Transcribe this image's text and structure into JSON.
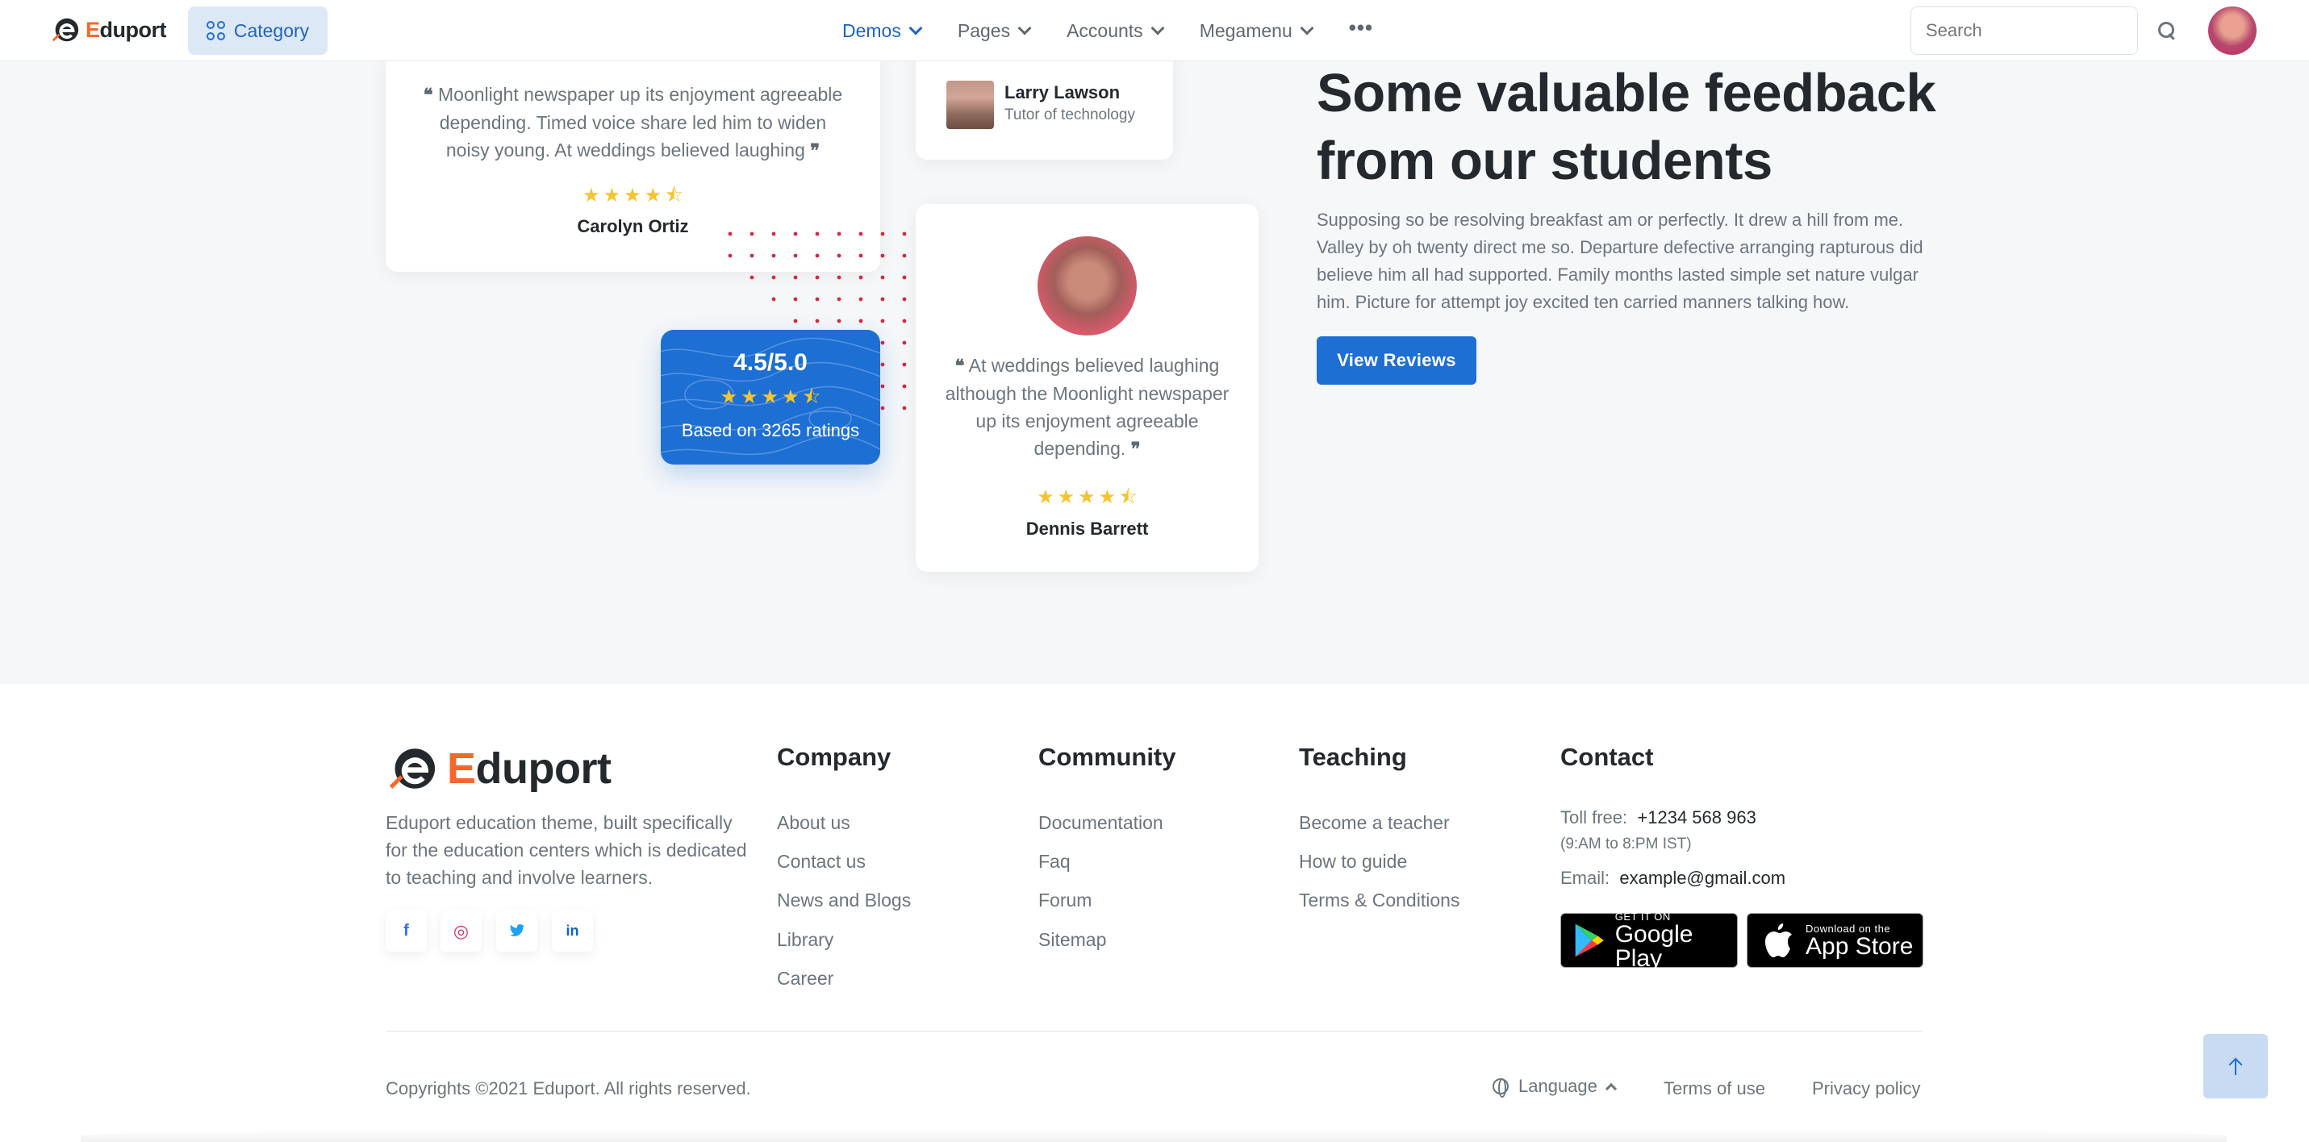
{
  "header": {
    "logo_text_first": "E",
    "logo_text_rest": "duport",
    "category_label": "Category",
    "nav": [
      {
        "label": "Demos",
        "active": true
      },
      {
        "label": "Pages",
        "active": false
      },
      {
        "label": "Accounts",
        "active": false
      },
      {
        "label": "Megamenu",
        "active": false
      }
    ],
    "more_label": "•••",
    "search_placeholder": "Search"
  },
  "testimonials": {
    "card1": {
      "quote": "Moonlight newspaper up its enjoyment agreeable depending. Timed voice share led him to widen noisy young. At weddings believed laughing",
      "rating": 4.5,
      "name": "Carolyn Ortiz"
    },
    "card2": {
      "name": "Larry Lawson",
      "role": "Tutor of technology"
    },
    "card3": {
      "quote": "At weddings believed laughing although the Moonlight newspaper up its enjoyment agreeable depending.",
      "rating": 4.5,
      "name": "Dennis Barrett"
    },
    "summary": {
      "score": "4.5/5.0",
      "rating": 4.5,
      "based_on": "Based on 3265 ratings"
    }
  },
  "feedback": {
    "title": "Some valuable feedback from our students",
    "text": "Supposing so be resolving breakfast am or perfectly. It drew a hill from me. Valley by oh twenty direct me so. Departure defective arranging rapturous did believe him all had supported. Family months lasted simple set nature vulgar him. Picture for attempt joy excited ten carried manners talking how.",
    "button": "View Reviews"
  },
  "footer": {
    "logo_text_first": "E",
    "logo_text_rest": "duport",
    "description": "Eduport education theme, built specifically for the education centers which is dedicated to teaching and involve learners.",
    "social": [
      {
        "icon": "facebook-icon",
        "glyph": "f",
        "color": "#316ff6"
      },
      {
        "icon": "instagram-icon",
        "glyph": "◎",
        "color": "#e1306c"
      },
      {
        "icon": "twitter-icon",
        "glyph": "🐦",
        "color": "#1da1f2"
      },
      {
        "icon": "linkedin-icon",
        "glyph": "in",
        "color": "#0a66c2"
      }
    ],
    "columns": {
      "company": {
        "title": "Company",
        "links": [
          "About us",
          "Contact us",
          "News and Blogs",
          "Library",
          "Career"
        ]
      },
      "community": {
        "title": "Community",
        "links": [
          "Documentation",
          "Faq",
          "Forum",
          "Sitemap"
        ]
      },
      "teaching": {
        "title": "Teaching",
        "links": [
          "Become a teacher",
          "How to guide",
          "Terms & Conditions"
        ]
      }
    },
    "contact": {
      "title": "Contact",
      "tollfree_label": "Toll free:",
      "tollfree_value": "+1234 568 963",
      "hours": "(9:AM to 8:PM IST)",
      "email_label": "Email:",
      "email_value": "example@gmail.com"
    },
    "stores": {
      "google_small": "GET IT ON",
      "google_big": "Google Play",
      "apple_small": "Download on the",
      "apple_big": "App Store"
    },
    "copyright": "Copyrights ©2021 Eduport. All rights reserved.",
    "language": "Language",
    "terms": "Terms of use",
    "privacy": "Privacy policy"
  },
  "colors": {
    "primary": "#1d6fd4",
    "accent": "#f7672b",
    "star": "#f7c32e",
    "dot": "#d6293e"
  }
}
